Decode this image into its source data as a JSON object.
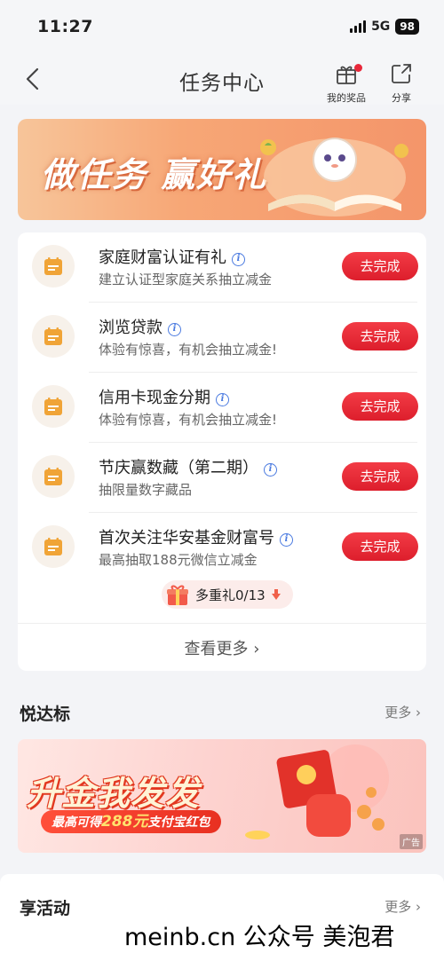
{
  "status_bar": {
    "time": "11:27",
    "network": "5G",
    "battery": "98"
  },
  "nav": {
    "title": "任务中心",
    "prize_label": "我的奖品",
    "share_label": "分享"
  },
  "banner": {
    "text": "做任务 赢好礼"
  },
  "tasks": [
    {
      "title": "家庭财富认证有礼",
      "desc": "建立认证型家庭关系抽立减金",
      "button": "去完成"
    },
    {
      "title": "浏览贷款",
      "desc": "体验有惊喜，有机会抽立减金!",
      "button": "去完成"
    },
    {
      "title": "信用卡现金分期",
      "desc": "体验有惊喜，有机会抽立减金!",
      "button": "去完成"
    },
    {
      "title": "节庆赢数藏（第二期）",
      "desc": "抽限量数字藏品",
      "button": "去完成"
    },
    {
      "title": "首次关注华安基金财富号",
      "desc": "最高抽取188元微信立减金",
      "button": "去完成"
    }
  ],
  "bonus": {
    "label": "多重礼0/13"
  },
  "more_label": "查看更多",
  "section1": {
    "title": "悦达标",
    "more": "更多"
  },
  "promo": {
    "title": "升金我发发",
    "sub_prefix": "最高可得",
    "sub_amount": "288元",
    "sub_suffix": "支付宝红包",
    "ad": "广告"
  },
  "section2": {
    "title": "享活动",
    "more": "更多"
  },
  "watermark": "meinb.cn  公众号 美泡君",
  "colors": {
    "accent_red": "#e8283a",
    "task_icon": "#f0a437",
    "info_blue": "#4a7ae0"
  }
}
